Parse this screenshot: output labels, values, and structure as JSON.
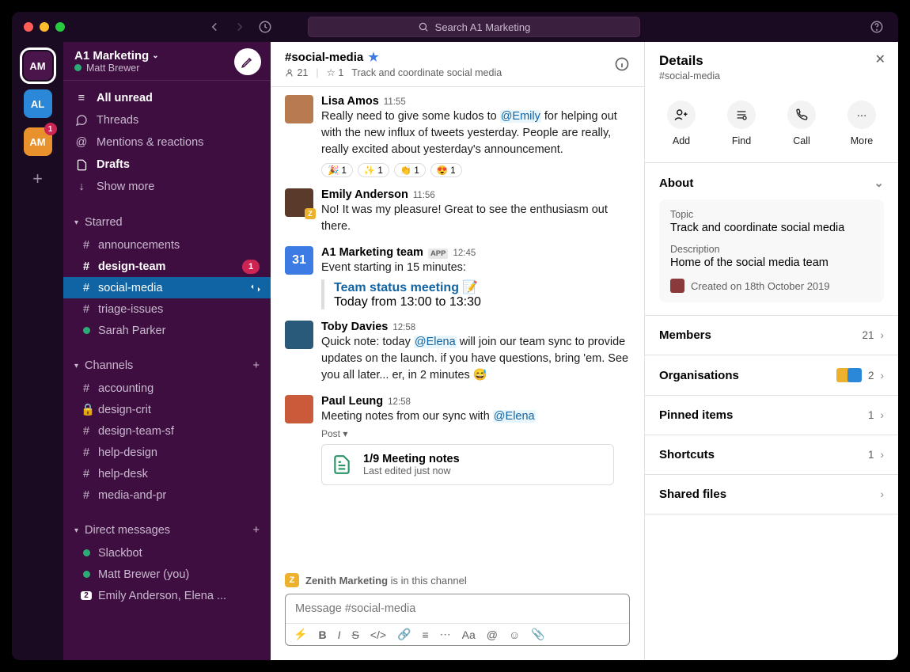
{
  "titlebar": {
    "search_text": "Search A1 Marketing"
  },
  "rail": {
    "workspaces": [
      {
        "label": "AM",
        "color": "#4a154b",
        "selected": true,
        "badge": null
      },
      {
        "label": "AL",
        "color": "#2b88d8",
        "selected": false,
        "badge": null
      },
      {
        "label": "AM",
        "color": "#e8912d",
        "selected": false,
        "badge": "1"
      }
    ]
  },
  "sidebar": {
    "workspace_name": "A1 Marketing",
    "user_name": "Matt Brewer",
    "nav": {
      "all_unread": "All unread",
      "threads": "Threads",
      "mentions": "Mentions & reactions",
      "drafts": "Drafts",
      "show_more": "Show more"
    },
    "starred": {
      "title": "Starred",
      "items": [
        {
          "prefix": "#",
          "label": "announcements",
          "bold": false
        },
        {
          "prefix": "#",
          "label": "design-team",
          "bold": true,
          "badge": "1"
        },
        {
          "prefix": "#",
          "label": "social-media",
          "bold": false,
          "active": true
        },
        {
          "prefix": "#",
          "label": "triage-issues",
          "bold": false
        },
        {
          "prefix": "presence",
          "label": "Sarah Parker",
          "bold": false
        }
      ]
    },
    "channels": {
      "title": "Channels",
      "items": [
        {
          "prefix": "#",
          "label": "accounting"
        },
        {
          "prefix": "lock",
          "label": "design-crit"
        },
        {
          "prefix": "#",
          "label": "design-team-sf"
        },
        {
          "prefix": "#",
          "label": "help-design"
        },
        {
          "prefix": "#",
          "label": "help-desk"
        },
        {
          "prefix": "#",
          "label": "media-and-pr"
        }
      ]
    },
    "dms": {
      "title": "Direct messages",
      "items": [
        {
          "prefix": "presence",
          "label": "Slackbot"
        },
        {
          "prefix": "presence",
          "label": "Matt Brewer (you)"
        },
        {
          "prefix": "count",
          "count": "2",
          "label": "Emily Anderson, Elena ..."
        }
      ]
    }
  },
  "channel": {
    "name": "#social-media",
    "members": "21",
    "pins": "1",
    "topic": "Track and coordinate social media",
    "messages": [
      {
        "author": "Lisa Amos",
        "time": "11:55",
        "avatar_color": "#b87a4f",
        "body_pre": "Really need to give some kudos to ",
        "mention": "@Emily",
        "body_post": " for helping out with the new influx of tweets yesterday. People are really, really excited about yesterday's announcement.",
        "reactions": [
          {
            "emoji": "🎉",
            "count": "1"
          },
          {
            "emoji": "✨",
            "count": "1"
          },
          {
            "emoji": "👏",
            "count": "1"
          },
          {
            "emoji": "😍",
            "count": "1"
          }
        ]
      },
      {
        "author": "Emily Anderson",
        "time": "11:56",
        "avatar_color": "#5a3a2a",
        "badge_z": true,
        "body": "No! It was my pleasure! Great to see the enthusiasm out there."
      },
      {
        "author": "A1 Marketing team",
        "time": "12:45",
        "avatar_color": "#3c7ae4",
        "app": true,
        "calendar_icon": true,
        "body": "Event starting in 15 minutes:",
        "event_title": "Team status meeting 📝",
        "event_time": "Today from 13:00 to 13:30"
      },
      {
        "author": "Toby Davies",
        "time": "12:58",
        "avatar_color": "#2a5a7a",
        "body_pre": "Quick note: today ",
        "mention": "@Elena",
        "body_post": " will join our team sync to provide updates on the launch. if you have questions, bring 'em. See you all later... er, in 2 minutes 😅"
      },
      {
        "author": "Paul Leung",
        "time": "12:58",
        "avatar_color": "#c95a3a",
        "body_pre": "Meeting notes from our sync with ",
        "mention": "@Elena",
        "body_post": "",
        "post": {
          "label": "Post ▾",
          "title": "1/9 Meeting notes",
          "sub": "Last edited just now"
        }
      }
    ],
    "shared_note_org": "Zenith Marketing",
    "shared_note_suffix": " is in this channel",
    "composer_placeholder": "Message #social-media"
  },
  "details": {
    "title": "Details",
    "sub": "#social-media",
    "actions": {
      "add": "Add",
      "find": "Find",
      "call": "Call",
      "more": "More"
    },
    "about_title": "About",
    "topic_label": "Topic",
    "topic_value": "Track and coordinate social media",
    "desc_label": "Description",
    "desc_value": "Home of the social media team",
    "created": "Created on 18th October 2019",
    "rows": {
      "members": {
        "label": "Members",
        "value": "21"
      },
      "orgs": {
        "label": "Organisations",
        "value": "2"
      },
      "pinned": {
        "label": "Pinned items",
        "value": "1"
      },
      "shortcuts": {
        "label": "Shortcuts",
        "value": "1"
      },
      "files": {
        "label": "Shared files",
        "value": ""
      }
    }
  }
}
